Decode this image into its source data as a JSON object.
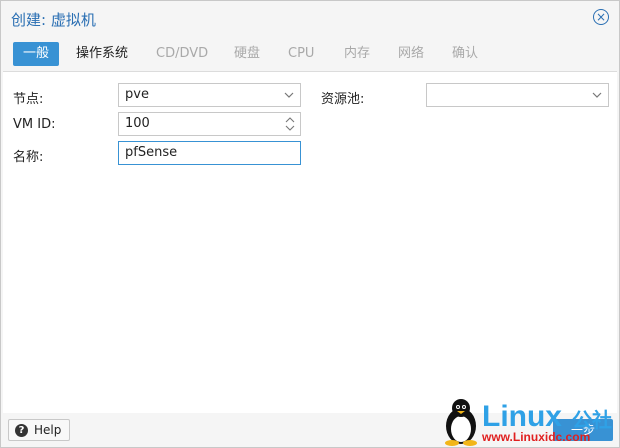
{
  "dialog": {
    "title": "创建: 虚拟机",
    "close_glyph": "×"
  },
  "tabs": [
    {
      "label": "一般",
      "state": "active"
    },
    {
      "label": "操作系统",
      "state": "enabled"
    },
    {
      "label": "CD/DVD",
      "state": "disabled"
    },
    {
      "label": "硬盘",
      "state": "disabled"
    },
    {
      "label": "CPU",
      "state": "disabled"
    },
    {
      "label": "内存",
      "state": "disabled"
    },
    {
      "label": "网络",
      "state": "disabled"
    },
    {
      "label": "确认",
      "state": "disabled"
    }
  ],
  "form": {
    "node_label": "节点:",
    "node_value": "pve",
    "vmid_label": "VM ID:",
    "vmid_value": "100",
    "name_label": "名称:",
    "name_value": "pfSense",
    "pool_label": "资源池:",
    "pool_value": ""
  },
  "footer": {
    "help_label": "Help",
    "help_icon": "?",
    "next_label": "一步"
  },
  "watermark": {
    "brand": "Linux",
    "brand_cn": "公社",
    "url": "www.Linuxidc.com"
  },
  "colors": {
    "accent": "#3892d4",
    "title": "#2a6fb3"
  }
}
